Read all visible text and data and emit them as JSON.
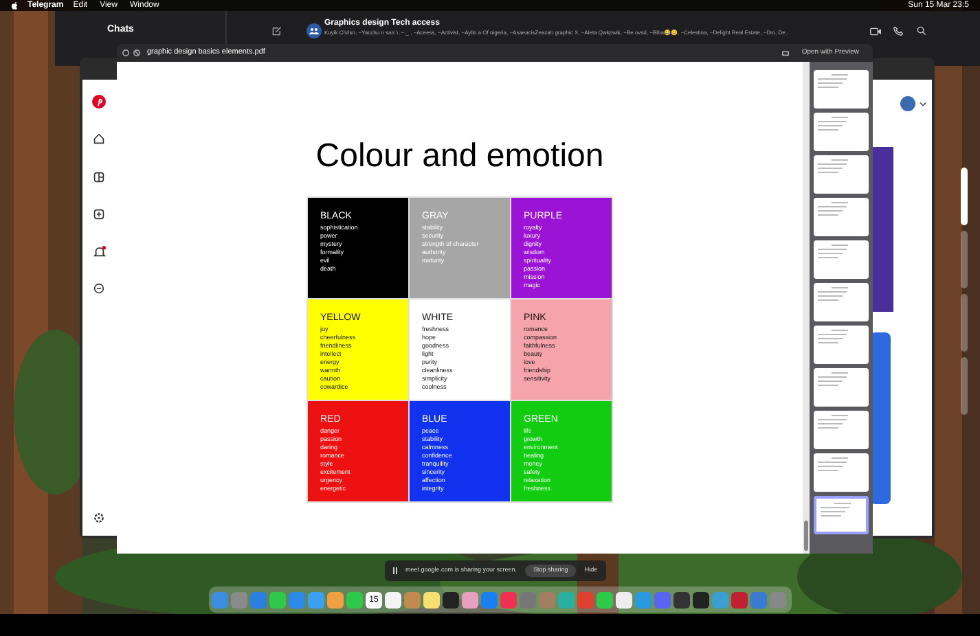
{
  "menu_bar": {
    "app": "Telegram",
    "items": [
      "Edit",
      "View",
      "Window"
    ],
    "clock": "Sun 15 Mar 23:5"
  },
  "telegram": {
    "header": "Chats",
    "group_title": "Graphics design Tech access",
    "group_members": "Kuyik Chrlsn, ~Yacchu n sarr \\, ~ _ , ~Aceess, ~Activist, ~Ayllo a Of nigeria, ~AsaeacisZeazah graphic X, ~Aleta Qwkpwik, ~Be ovsd, ~Biba😂😊, ~Celestina, ~Delight Real Estate, ~Dro, De..."
  },
  "pdf_viewer": {
    "file_name": "graphic design basics elements.pdf",
    "open_button": "Open with Preview",
    "page_title": "Colour and emotion",
    "cells": [
      {
        "name": "BLACK",
        "color": "#000000",
        "words": [
          "sophistication",
          "power",
          "mystery",
          "formality",
          "evil",
          "death"
        ]
      },
      {
        "name": "GRAY",
        "color": "#a6a6a6",
        "words": [
          "stability",
          "security",
          "strength of character",
          "authority",
          "maturity"
        ]
      },
      {
        "name": "PURPLE",
        "color": "#9b14d6",
        "words": [
          "royalty",
          "luxury",
          "dignity",
          "wisdom",
          "spirituality",
          "passion",
          "mission",
          "magic"
        ]
      },
      {
        "name": "YELLOW",
        "color": "#ffff00",
        "words": [
          "joy",
          "cheerfulness",
          "friendliness",
          "intellect",
          "energy",
          "warmth",
          "caution",
          "cowardice"
        ]
      },
      {
        "name": "WHITE",
        "color": "#ffffff",
        "words": [
          "freshness",
          "hope",
          "goodness",
          "light",
          "purity",
          "cleanliness",
          "simplicity",
          "coolness"
        ]
      },
      {
        "name": "PINK",
        "color": "#f4a4aa",
        "words": [
          "romance",
          "compassion",
          "faithfulness",
          "beauty",
          "love",
          "friendship",
          "sensitivity"
        ]
      },
      {
        "name": "RED",
        "color": "#ee1111",
        "words": [
          "danger",
          "passion",
          "daring",
          "romance",
          "style",
          "excitement",
          "urgency",
          "energetic"
        ]
      },
      {
        "name": "BLUE",
        "color": "#1133f0",
        "words": [
          "peace",
          "stability",
          "calmness",
          "confidence",
          "tranquility",
          "sincerity",
          "affection",
          "integrity"
        ]
      },
      {
        "name": "GREEN",
        "color": "#11cc11",
        "words": [
          "life",
          "growth",
          "environment",
          "healing",
          "money",
          "safety",
          "relaxation",
          "freshness"
        ]
      }
    ],
    "thumbnails": [
      {
        "selected": false
      },
      {
        "selected": false
      },
      {
        "selected": false
      },
      {
        "selected": false
      },
      {
        "selected": false
      },
      {
        "selected": false
      },
      {
        "selected": false
      },
      {
        "selected": false
      },
      {
        "selected": false
      },
      {
        "selected": false
      },
      {
        "selected": true
      }
    ]
  },
  "screen_share": {
    "message": "meet.google.com is sharing your screen.",
    "stop_button": "Stop sharing",
    "hide_button": "Hide"
  },
  "dock": {
    "calendar_day": "15"
  }
}
